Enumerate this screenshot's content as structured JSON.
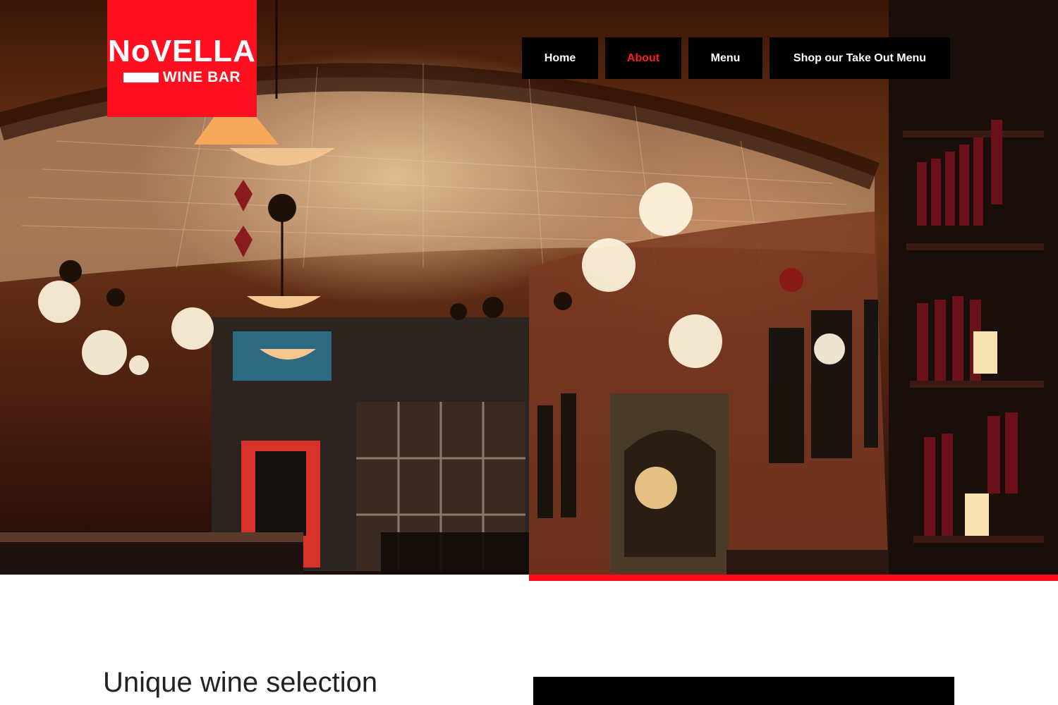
{
  "brand": {
    "logo_main": "NoVELLA",
    "logo_sub": "WINE BAR",
    "accent_color": "#ff0f1f"
  },
  "nav": {
    "items": [
      {
        "label": "Home",
        "active": false
      },
      {
        "label": "About",
        "active": true
      },
      {
        "label": "Menu",
        "active": false
      },
      {
        "label": "Shop our Take Out Menu",
        "active": false
      }
    ],
    "active_color": "#ff1a1a"
  },
  "hero": {
    "image": "wine-bar-interior-photo"
  },
  "content": {
    "section_title": "Unique wine selection"
  }
}
